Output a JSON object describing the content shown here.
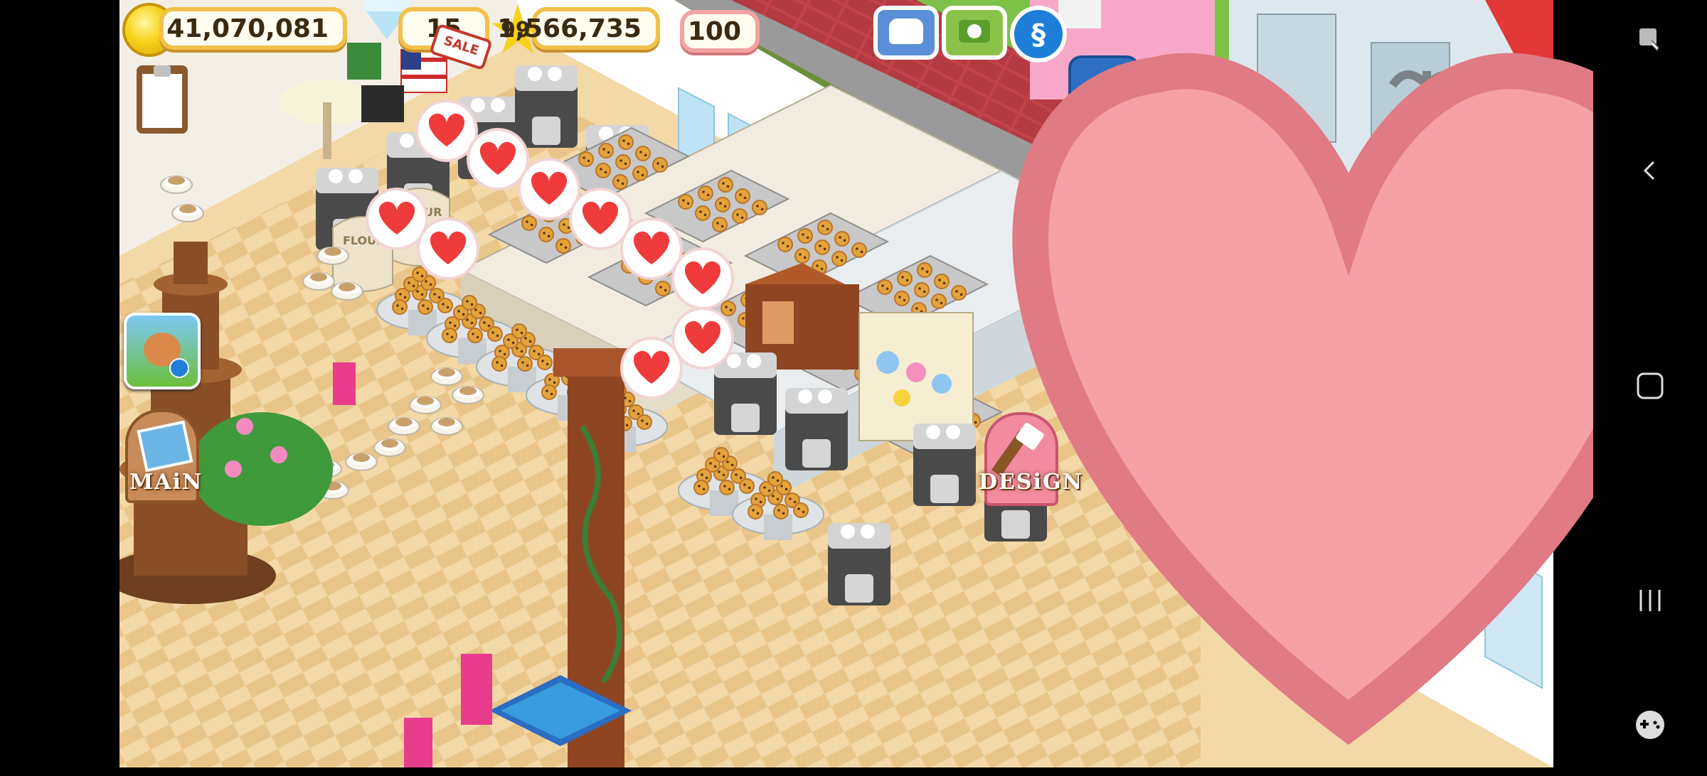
{
  "hud": {
    "coins": "41,070,081",
    "gems": "15",
    "sale_label": "SALE",
    "level": "99",
    "xp": "1,566,735",
    "hearts": "100"
  },
  "buttons": {
    "main_label": "MAiN",
    "design_label": "DESiGN"
  },
  "signage": {
    "flour_label": "FLOUR"
  },
  "icons": {
    "coin": "coin-icon",
    "gem": "gem-icon",
    "star": "star-icon",
    "heart": "heart-icon",
    "phone": "phone-icon",
    "camera": "camera-icon",
    "social": "social-icon",
    "clipboard": "clipboard-icon",
    "cross_promo": "farm-app-icon"
  },
  "colors": {
    "hud_border": "#f2c14a",
    "heart_red": "#ef3b3b",
    "street": "#8c8c8c",
    "sidewalk": "#c0393b"
  },
  "system_nav": {
    "accessibility": "accessibility-icon",
    "back": "back-icon",
    "home": "home-icon",
    "recents": "recents-icon",
    "game_tools": "game-tools-icon"
  }
}
